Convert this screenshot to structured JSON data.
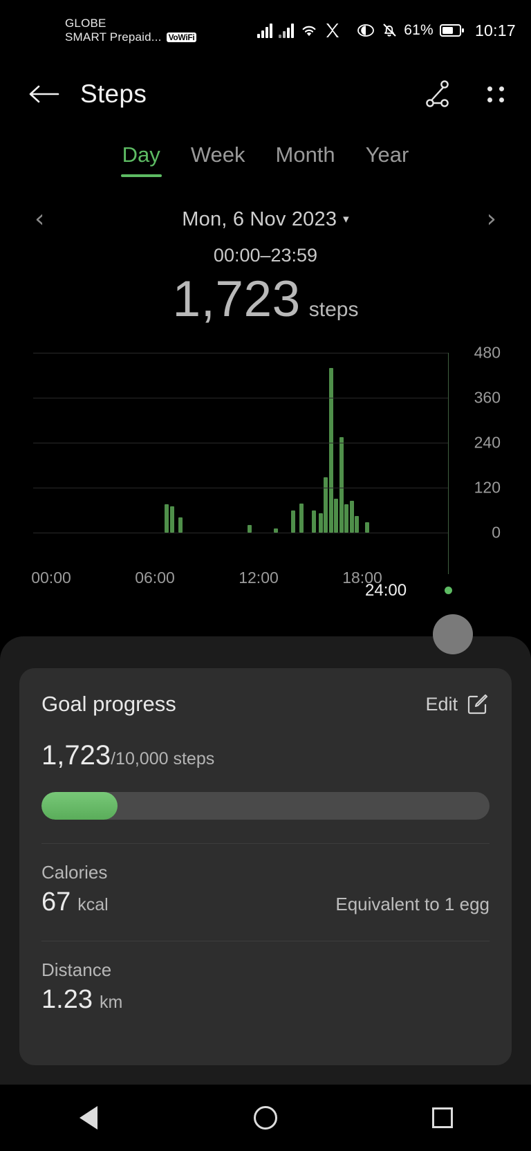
{
  "status_bar": {
    "carrier_line1": "GLOBE",
    "carrier_line2": "SMART Prepaid...",
    "vowifi_badge": "VoWiFi",
    "icons": [
      "signal-bars-icon",
      "signal-bars-icon",
      "wifi-icon",
      "x-app-icon",
      "eye-comfort-icon",
      "mute-bell-icon"
    ],
    "battery_percent": "61%",
    "clock": "10:17"
  },
  "app_bar": {
    "back_label": "←",
    "title": "Steps",
    "share_icon": "share-nodes-icon",
    "menu_icon": "four-dots-menu-icon"
  },
  "tabs": [
    {
      "label": "Day",
      "active": true
    },
    {
      "label": "Week",
      "active": false
    },
    {
      "label": "Month",
      "active": false
    },
    {
      "label": "Year",
      "active": false
    }
  ],
  "date_nav": {
    "prev": "‹",
    "next": "›",
    "date": "Mon, 6 Nov 2023",
    "caret": "▾",
    "time_range": "00:00–23:59"
  },
  "summary": {
    "value": "1,723",
    "unit": "steps"
  },
  "chart_data": {
    "type": "bar",
    "title": "Steps per 10-minute interval",
    "xlabel": "",
    "ylabel": "",
    "ylim": [
      0,
      480
    ],
    "yticks": [
      0,
      120,
      240,
      360,
      480
    ],
    "ytick_labels": [
      "0",
      "120",
      "240",
      "360",
      "480"
    ],
    "xticks": [
      0,
      6,
      12,
      18
    ],
    "xtick_labels": [
      "00:00",
      "06:00",
      "12:00",
      "18:00"
    ],
    "grid": true,
    "marker_label": "24:00",
    "accent_color": "#5dbb63",
    "bar_color": "#4f8f4a",
    "x_hours": [
      7.6,
      7.9,
      8.4,
      12.4,
      13.9,
      14.9,
      15.4,
      16.1,
      16.5,
      16.8,
      17.1,
      17.4,
      17.7,
      18.0,
      18.3,
      18.6,
      19.2
    ],
    "values": [
      75,
      70,
      40,
      20,
      12,
      60,
      78,
      60,
      52,
      148,
      440,
      90,
      255,
      75,
      85,
      45,
      28
    ]
  },
  "goal_card": {
    "title": "Goal progress",
    "edit_label": "Edit",
    "edit_icon": "pencil-square-icon",
    "current": "1,723",
    "target": "/10,000 steps",
    "progress_percent": 17,
    "progress_color": "#6dbf6d",
    "metrics": [
      {
        "label": "Calories",
        "value": "67",
        "unit": "kcal",
        "note": "Equivalent to 1 egg"
      },
      {
        "label": "Distance",
        "value": "1.23",
        "unit": "km",
        "note": ""
      }
    ]
  },
  "nav_bar": {
    "back_icon": "triangle-back-icon",
    "home_icon": "circle-home-icon",
    "recents_icon": "square-recents-icon"
  }
}
